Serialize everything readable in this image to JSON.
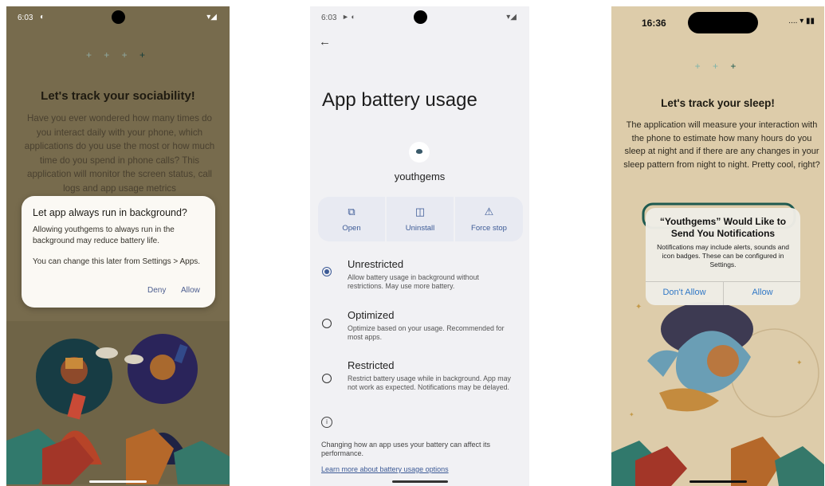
{
  "phone1": {
    "status": {
      "time": "6:03"
    },
    "title": "Let's track your sociability!",
    "body": "Have you ever wondered how many times do you interact daily with your phone, which applications do you use the most or how much time do you spend in phone calls? This application will monitor the screen status, call logs and app usage metrics",
    "dialog": {
      "title": "Let app always run in background?",
      "message": "Allowing youthgems to always run in the background may reduce battery life.",
      "note": "You can change this later from Settings > Apps.",
      "deny": "Deny",
      "allow": "Allow"
    }
  },
  "phone2": {
    "status": {
      "time": "6:03"
    },
    "heading": "App battery usage",
    "app_name": "youthgems",
    "actions": [
      {
        "label": "Open",
        "icon": "open-external-icon"
      },
      {
        "label": "Uninstall",
        "icon": "trash-icon"
      },
      {
        "label": "Force stop",
        "icon": "warning-icon"
      }
    ],
    "options": [
      {
        "title": "Unrestricted",
        "desc": "Allow battery usage in background without restrictions. May use more battery.",
        "selected": true
      },
      {
        "title": "Optimized",
        "desc": "Optimize based on your usage. Recommended for most apps.",
        "selected": false
      },
      {
        "title": "Restricted",
        "desc": "Restrict battery usage while in background. App may not work as expected. Notifications may be delayed.",
        "selected": false
      }
    ],
    "footer": "Changing how an app uses your battery can affect its performance.",
    "link": "Learn more about battery usage options"
  },
  "phone3": {
    "status": {
      "time": "16:36"
    },
    "title": "Let's track your sleep!",
    "body": "The application will measure your interaction with the phone to estimate how many hours do you sleep at night and if there are any changes in your sleep pattern from night to night. Pretty cool, right?",
    "dialog": {
      "title": "“Youthgems” Would Like to Send You Notifications",
      "message": "Notifications may include alerts, sounds and icon badges. These can be configured in Settings.",
      "dont_allow": "Don't Allow",
      "allow": "Allow"
    }
  },
  "colors": {
    "android_accent": "#3c5a96",
    "ios_link": "#3178c6",
    "phone1_bg": "#776b4d",
    "phone3_bg": "#ddccaa"
  }
}
